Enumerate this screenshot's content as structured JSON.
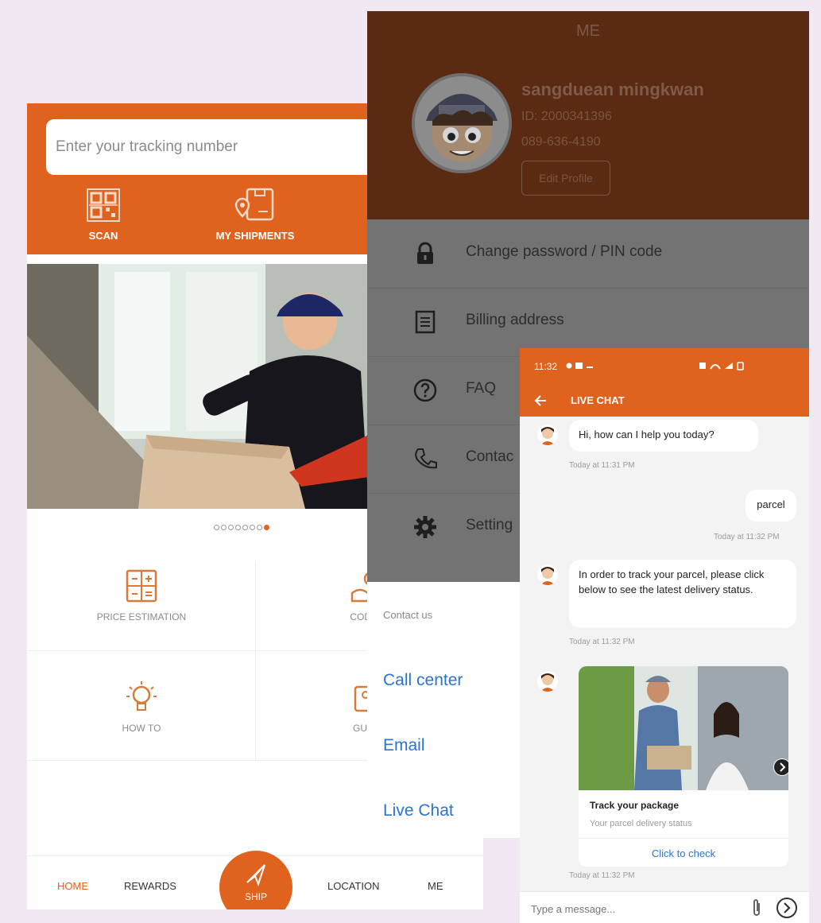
{
  "home": {
    "search_placeholder": "Enter your tracking number",
    "quick_actions": [
      {
        "label": "SCAN",
        "icon": "qr-code-icon"
      },
      {
        "label": "MY SHIPMENTS",
        "icon": "parcel-location-icon"
      }
    ],
    "carousel": {
      "dots_total": 8,
      "active_index": 7
    },
    "services": [
      {
        "label": "PRICE ESTIMATION",
        "icon": "calculator-icon"
      },
      {
        "label": "COD A",
        "icon": "hand-money-icon"
      },
      {
        "label": "HOW TO",
        "icon": "lightbulb-icon"
      },
      {
        "label": "GUID",
        "icon": "guide-icon"
      }
    ],
    "bottom_nav": {
      "home": "HOME",
      "rewards": "REWARDS",
      "ship": "SHIP",
      "location": "LOCATION",
      "me": "ME"
    },
    "accent_color": "#e0621f"
  },
  "profile": {
    "title": "ME",
    "name": "sangduean mingkwan",
    "id": "ID: 2000341396",
    "phone": "089-636-4190",
    "edit_label": "Edit Profile",
    "menu": [
      {
        "label": "Change password / PIN code",
        "icon": "lock-icon"
      },
      {
        "label": "Billing address",
        "icon": "receipt-icon"
      },
      {
        "label": "FAQ",
        "icon": "question-circle-icon"
      },
      {
        "label": "Contac",
        "icon": "phone-icon"
      },
      {
        "label": "Setting",
        "icon": "gear-icon"
      }
    ],
    "header_color": "#5a2a12"
  },
  "contact_sheet": {
    "heading": "Contact us",
    "options": [
      "Call center",
      "Email",
      "Live Chat"
    ],
    "link_color": "#2b73d2"
  },
  "chat": {
    "status_time": "11:32",
    "title": "LIVE CHAT",
    "messages": [
      {
        "from": "agent",
        "text": "Hi, how can I help you today?",
        "time": "Today at 11:31 PM"
      },
      {
        "from": "user",
        "text": "parcel",
        "time": "Today at 11:32 PM"
      },
      {
        "from": "agent",
        "text": "In order to track your parcel, please click below to see the latest delivery status.",
        "time": "Today at 11:32 PM"
      }
    ],
    "card": {
      "title": "Track your package",
      "subtitle": "Your parcel delivery status",
      "action": "Click to check",
      "time": "Today at 11:32 PM"
    },
    "composer_placeholder": "Type a message..."
  }
}
